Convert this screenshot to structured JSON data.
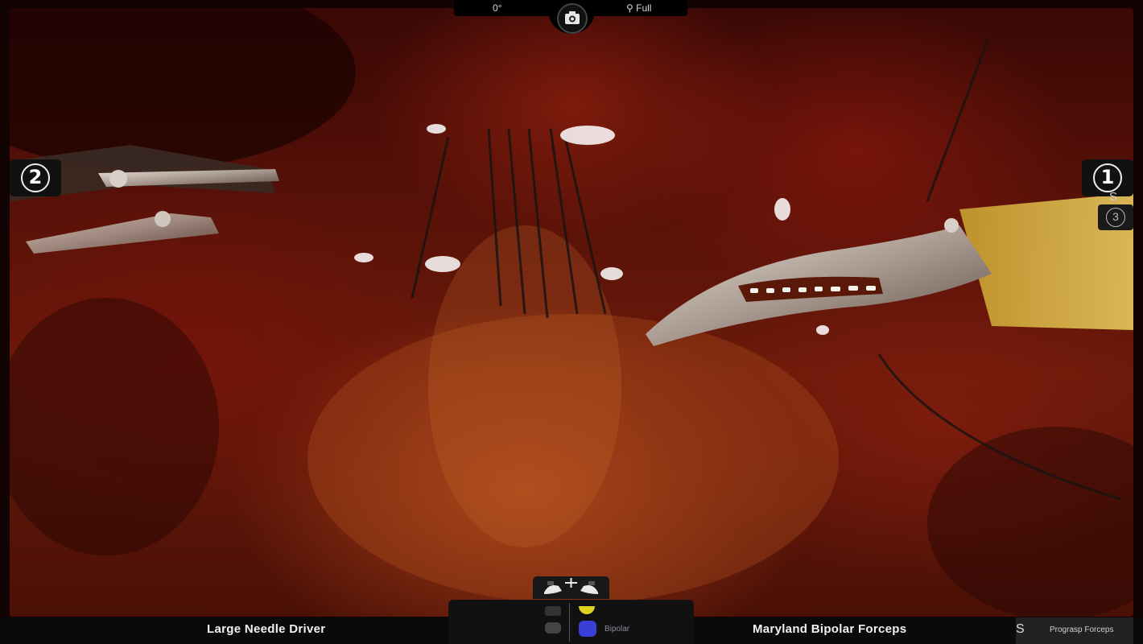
{
  "hud": {
    "angle": "0°",
    "zoom_label": "Full"
  },
  "arms": {
    "left_number": "2",
    "right_number": "1",
    "standby_number": "3",
    "swap_symbol": "S"
  },
  "tools": {
    "left_tool": "Large Needle Driver",
    "right_tool": "Maryland Bipolar Forceps",
    "standby_tool": "Prograsp Forceps",
    "energy_mode": "Bipolar"
  },
  "colors": {
    "bipolar_pedal": "#3a3fd8",
    "yellow_pedal": "#e0d020"
  }
}
